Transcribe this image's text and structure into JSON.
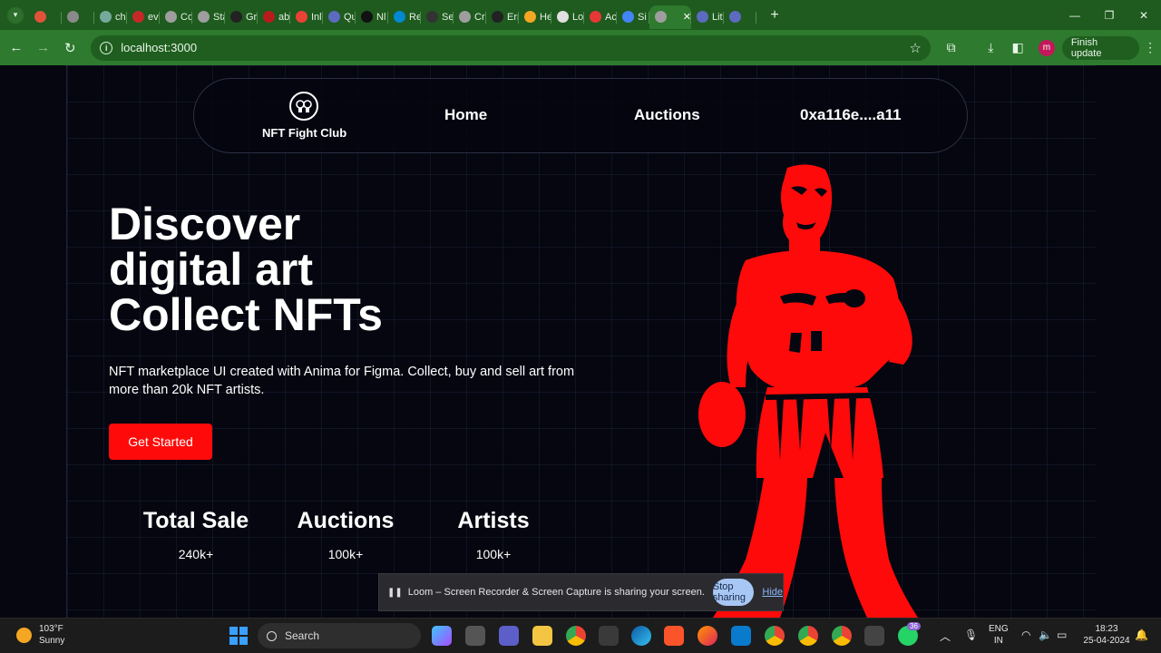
{
  "browser": {
    "tabs": [
      {
        "label": "",
        "color": "#e0523a"
      },
      {
        "label": "",
        "color": "#8a8a8a"
      },
      {
        "label": "ch",
        "color": "#74aa9c"
      },
      {
        "label": "ev",
        "color": "#c62828"
      },
      {
        "label": "Co",
        "color": "#9e9e9e"
      },
      {
        "label": "Sta",
        "color": "#9e9e9e"
      },
      {
        "label": "Gr",
        "color": "#222222"
      },
      {
        "label": "ab",
        "color": "#b71c1c"
      },
      {
        "label": "Inl",
        "color": "#ea4335"
      },
      {
        "label": "Qu",
        "color": "#5c6bc0"
      },
      {
        "label": "Nl",
        "color": "#111111"
      },
      {
        "label": "Re",
        "color": "#0288d1"
      },
      {
        "label": "Se",
        "color": "#333333"
      },
      {
        "label": "Cr",
        "color": "#9e9e9e"
      },
      {
        "label": "Err",
        "color": "#222222"
      },
      {
        "label": "He",
        "color": "#f5a623"
      },
      {
        "label": "Lo",
        "color": "#e0e0e0"
      },
      {
        "label": "Ac",
        "color": "#e53935"
      },
      {
        "label": "Si",
        "color": "#4285f4"
      }
    ],
    "active_tab": {
      "label": "",
      "color": "#9e9e9e"
    },
    "after_tabs": [
      {
        "label": "Lit",
        "color": "#5c6bc0"
      },
      {
        "label": "",
        "color": "#5c6bc0"
      }
    ],
    "url": "localhost:3000",
    "profile_initial": "m",
    "finish_update": "Finish update"
  },
  "nav": {
    "logo_text": "NFT Fight Club",
    "links": [
      "Home",
      "Auctions"
    ],
    "wallet": "0xa116e....a11"
  },
  "hero": {
    "title_lines": [
      "Discover",
      "digital art",
      "Collect NFTs"
    ],
    "subtitle": "NFT marketplace UI created with Anima for Figma. Collect, buy and sell art from more than 20k NFT artists.",
    "cta": "Get Started"
  },
  "stats": [
    {
      "label": "Total Sale",
      "value": "240k+"
    },
    {
      "label": "Auctions",
      "value": "100k+"
    },
    {
      "label": "Artists",
      "value": "100k+"
    }
  ],
  "accent_color": "#ff0a0a",
  "loom": {
    "message": "Loom – Screen Recorder & Screen Capture is sharing your screen.",
    "stop": "Stop sharing",
    "hide": "Hide"
  },
  "taskbar": {
    "temp": "103°F",
    "condition": "Sunny",
    "search": "Search",
    "lang1": "ENG",
    "lang2": "IN",
    "time": "18:23",
    "date": "25-04-2024",
    "whatsapp_badge": "36"
  }
}
